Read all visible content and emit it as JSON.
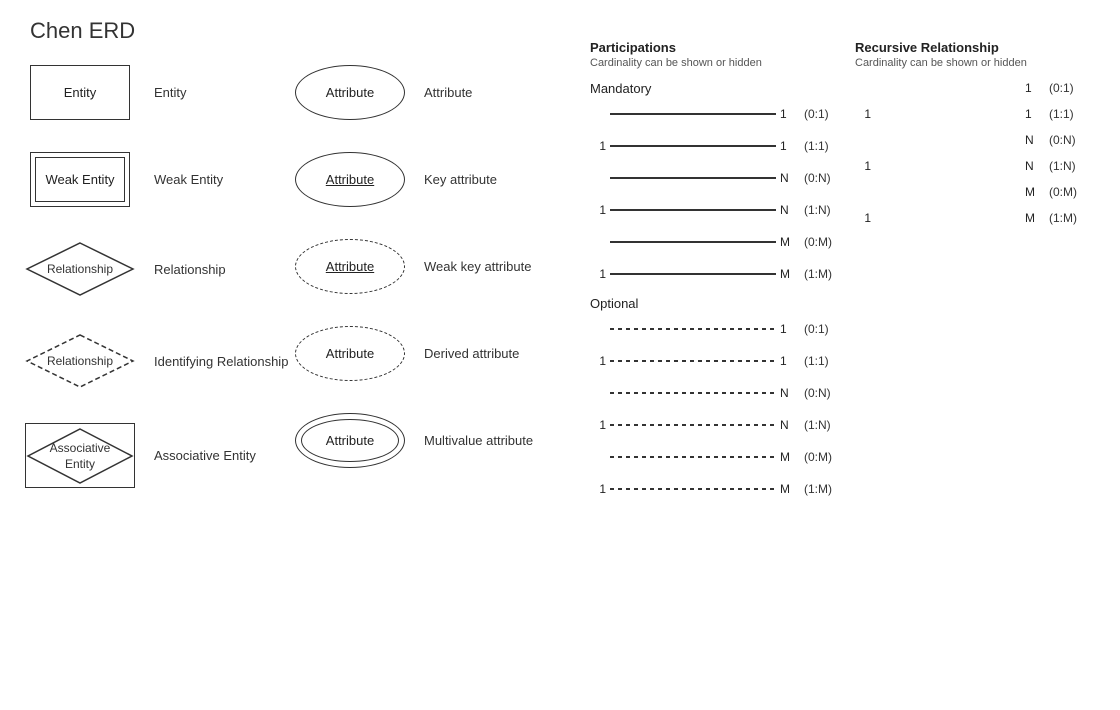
{
  "title": "Chen ERD",
  "shapes": [
    {
      "id": "entity",
      "label": "Entity",
      "desc": "Entity"
    },
    {
      "id": "weak-entity",
      "label": "Weak Entity",
      "desc": "Weak Entity"
    },
    {
      "id": "relationship",
      "label": "Relationship",
      "desc": "Relationship"
    },
    {
      "id": "identifying-rel",
      "label": "Relationship",
      "desc": "Identifying Relationship"
    },
    {
      "id": "associative",
      "label": "Associative\nEntity",
      "desc": "Associative Entity"
    }
  ],
  "attributes": [
    {
      "id": "attr",
      "label": "Attribute",
      "desc": "Attribute",
      "type": "normal"
    },
    {
      "id": "key-attr",
      "label": "Attribute",
      "desc": "Key attribute",
      "type": "key"
    },
    {
      "id": "weak-key-attr",
      "label": "Attribute",
      "desc": "Weak key attribute",
      "type": "weak-key"
    },
    {
      "id": "derived-attr",
      "label": "Attribute",
      "desc": "Derived attribute",
      "type": "derived"
    },
    {
      "id": "multi-attr",
      "label": "Attribute",
      "desc": "Multivalue attribute",
      "type": "multivalue"
    }
  ],
  "participations": {
    "title": "Participations",
    "subtitle": "Cardinality can be shown or hidden",
    "mandatory_label": "Mandatory",
    "optional_label": "Optional",
    "mandatory_rows": [
      {
        "left": "",
        "right": "1",
        "notation": "(0:1)"
      },
      {
        "left": "1",
        "right": "1",
        "notation": "(1:1)"
      },
      {
        "left": "",
        "right": "N",
        "notation": "(0:N)"
      },
      {
        "left": "1",
        "right": "N",
        "notation": "(1:N)"
      },
      {
        "left": "",
        "right": "M",
        "notation": "(0:M)"
      },
      {
        "left": "1",
        "right": "M",
        "notation": "(1:M)"
      }
    ],
    "optional_rows": [
      {
        "left": "",
        "right": "1",
        "notation": "(0:1)"
      },
      {
        "left": "1",
        "right": "1",
        "notation": "(1:1)"
      },
      {
        "left": "",
        "right": "N",
        "notation": "(0:N)"
      },
      {
        "left": "1",
        "right": "N",
        "notation": "(1:N)"
      },
      {
        "left": "",
        "right": "M",
        "notation": "(0:M)"
      },
      {
        "left": "1",
        "right": "M",
        "notation": "(1:M)"
      }
    ]
  },
  "recursive": {
    "title": "Recursive Relationship",
    "subtitle": "Cardinality can be shown or hidden",
    "rows": [
      {
        "right": "1",
        "notation": "(0:1)"
      },
      {
        "left": "1",
        "right": "1",
        "notation": "(1:1)"
      },
      {
        "right": "N",
        "notation": "(0:N)"
      },
      {
        "left": "1",
        "right": "N",
        "notation": "(1:N)"
      },
      {
        "right": "M",
        "notation": "(0:M)"
      },
      {
        "left": "1",
        "right": "M",
        "notation": "(1:M)"
      }
    ]
  }
}
